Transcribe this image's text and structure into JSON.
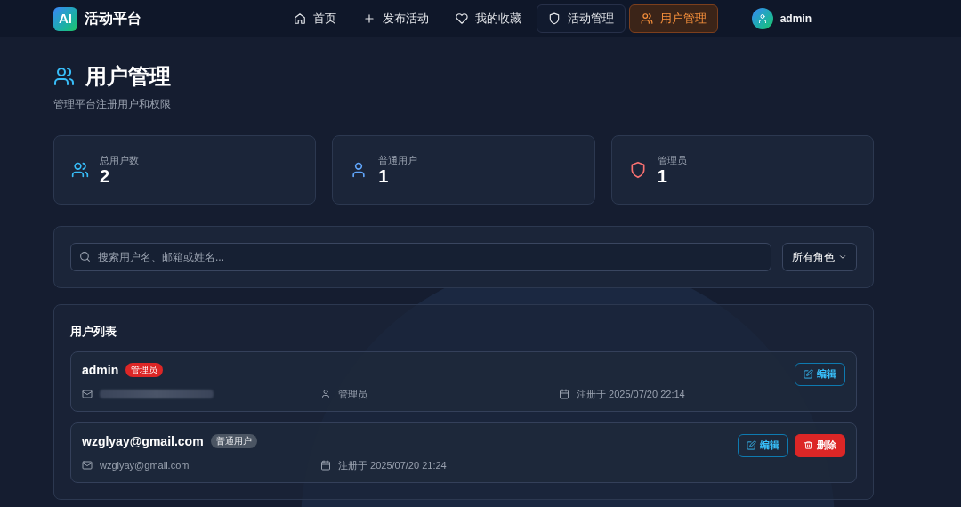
{
  "header": {
    "logo_mark": "AI",
    "brand": "活动平台",
    "nav": [
      {
        "label": "首页",
        "kind": "home",
        "selected": false,
        "outlined": false
      },
      {
        "label": "发布活动",
        "kind": "plus",
        "selected": false,
        "outlined": false
      },
      {
        "label": "我的收藏",
        "kind": "heart",
        "selected": false,
        "outlined": false
      },
      {
        "label": "活动管理",
        "kind": "shield",
        "selected": false,
        "outlined": true
      },
      {
        "label": "用户管理",
        "kind": "users",
        "selected": true,
        "outlined": true
      }
    ],
    "user": "admin"
  },
  "page": {
    "title": "用户管理",
    "subtitle": "管理平台注册用户和权限"
  },
  "stats": [
    {
      "label": "总用户数",
      "value": "2",
      "kind": "users",
      "color": "#38bdf8"
    },
    {
      "label": "普通用户",
      "value": "1",
      "kind": "user",
      "color": "#60a5fa"
    },
    {
      "label": "管理员",
      "value": "1",
      "kind": "shield",
      "color": "#f87171"
    }
  ],
  "filters": {
    "search": {
      "placeholder": "搜索用户名、邮箱或姓名..."
    },
    "role_select": {
      "value": "所有角色"
    }
  },
  "user_list": {
    "title": "用户列表",
    "users": [
      {
        "name": "admin",
        "badge": {
          "label": "管理员",
          "kind": "admin"
        },
        "meta": [
          {
            "kind": "email",
            "blurred": true
          },
          {
            "kind": "role",
            "text": "管理员",
            "blurred": false
          },
          {
            "kind": "date",
            "text": "注册于 2025/07/20 22:14",
            "blurred": false
          }
        ],
        "actions": [
          {
            "kind": "edit",
            "label": "编辑"
          }
        ]
      },
      {
        "name": "wzglyay@gmail.com",
        "badge": {
          "label": "普通用户",
          "kind": "user"
        },
        "meta": [
          {
            "kind": "email",
            "text": "wzglyay@gmail.com",
            "blurred": false
          },
          {
            "kind": "date",
            "text": "注册于 2025/07/20 21:24",
            "blurred": false
          }
        ],
        "actions": [
          {
            "kind": "edit",
            "label": "编辑"
          },
          {
            "kind": "delete",
            "label": "删除"
          }
        ]
      }
    ]
  }
}
